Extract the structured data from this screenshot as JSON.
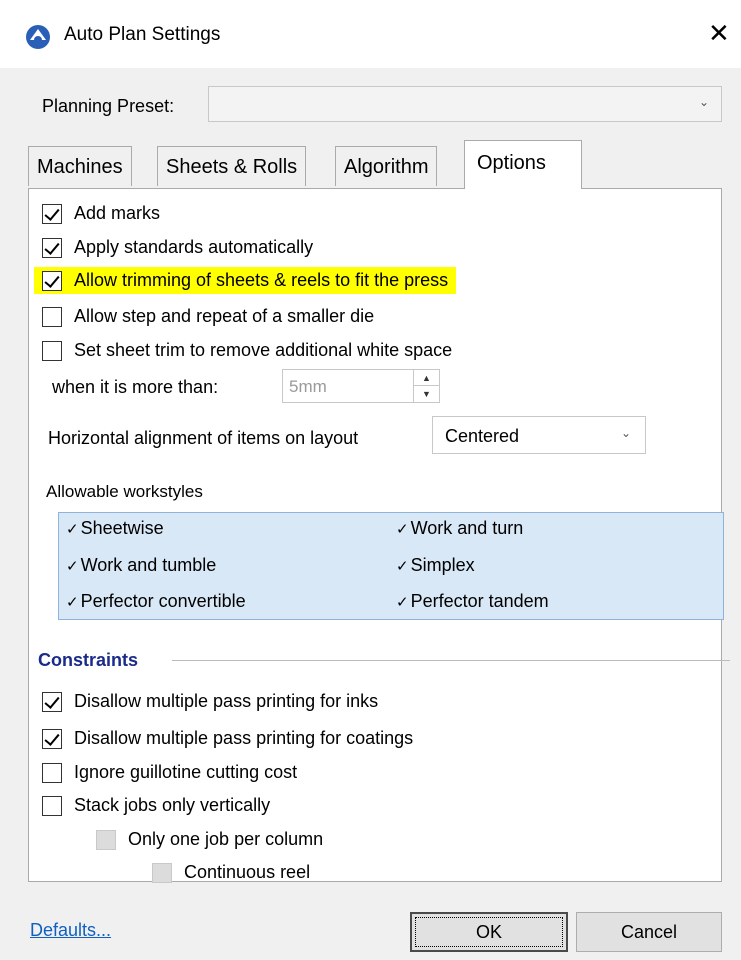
{
  "window": {
    "title": "Auto Plan Settings",
    "close_glyph": "✕"
  },
  "preset": {
    "label": "Planning Preset:",
    "value": ""
  },
  "tabs": [
    "Machines",
    "Sheets & Rolls",
    "Algorithm",
    "Options"
  ],
  "active_tab": "Options",
  "options": [
    {
      "label": "Add marks",
      "checked": true
    },
    {
      "label": "Apply standards automatically",
      "checked": true
    },
    {
      "label": "Allow trimming of sheets & reels to fit the press",
      "checked": true,
      "highlighted": true
    },
    {
      "label": "Allow step and repeat of a smaller die",
      "checked": false
    },
    {
      "label": "Set sheet trim to remove additional white space",
      "checked": false
    }
  ],
  "trim": {
    "label": "when it is more than:",
    "value": "5mm"
  },
  "alignment": {
    "label": "Horizontal alignment of items on layout",
    "value": "Centered"
  },
  "workstyles": {
    "label": "Allowable workstyles",
    "check_glyph": "✓",
    "items": [
      "Sheetwise",
      "Work and turn",
      "Work and tumble",
      "Simplex",
      "Perfector convertible",
      "Perfector tandem"
    ]
  },
  "constraints": {
    "title": "Constraints",
    "items": [
      {
        "label": "Disallow multiple pass printing for inks",
        "checked": true
      },
      {
        "label": "Disallow multiple pass printing for coatings",
        "checked": true
      },
      {
        "label": "Ignore guillotine cutting cost",
        "checked": false
      },
      {
        "label": "Stack jobs only vertically",
        "checked": false
      },
      {
        "label": "Only one job per column",
        "checked": false,
        "disabled": true
      },
      {
        "label": "Continuous reel",
        "checked": false,
        "disabled": true
      }
    ]
  },
  "footer": {
    "defaults_label": "Defaults...",
    "ok_label": "OK",
    "cancel_label": "Cancel"
  },
  "colors": {
    "highlight": "#ffff00",
    "workstyles_bg": "#d9e8f6",
    "link": "#1060c0",
    "group_title": "#1a2b8a"
  }
}
